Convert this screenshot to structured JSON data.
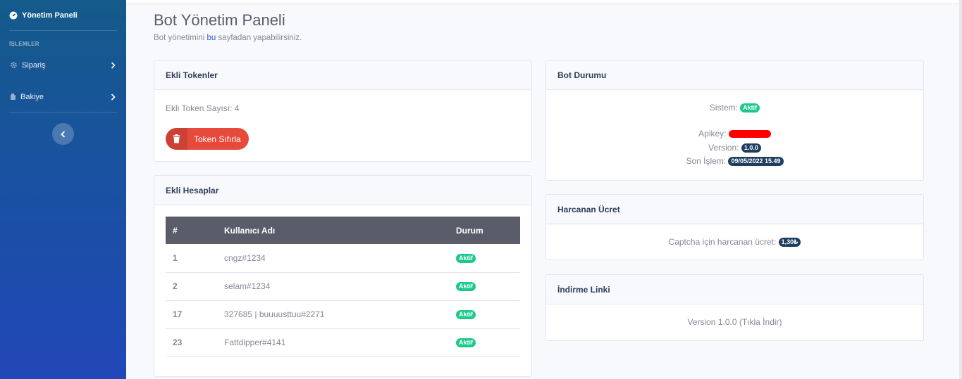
{
  "sidebar": {
    "brand": "Yönetim Paneli",
    "heading": "İŞLEMLER",
    "items": [
      {
        "label": "Sipariş"
      },
      {
        "label": "Bakiye"
      }
    ]
  },
  "header": {
    "title": "Bot Yönetim Paneli",
    "subtitle_pre": "Bot yönetimini ",
    "subtitle_hl": "bu",
    "subtitle_post": " sayfadan yapabilirsiniz."
  },
  "tokens": {
    "title": "Ekli Tokenler",
    "count_text": "Ekli Token Sayısı: 4",
    "reset_label": "Token Sıfırla"
  },
  "accounts": {
    "title": "Ekli Hesaplar",
    "columns": [
      "#",
      "Kullanıcı Adı",
      "Durum"
    ],
    "rows": [
      {
        "id": "1",
        "user": "cngz#1234",
        "status": "Aktif"
      },
      {
        "id": "2",
        "user": "selam#1234",
        "status": "Aktif"
      },
      {
        "id": "17",
        "user": "327685 | buuuusttuu#2271",
        "status": "Aktif"
      },
      {
        "id": "23",
        "user": "Fattdipper#4141",
        "status": "Aktif"
      }
    ]
  },
  "bot_status": {
    "title": "Bot Durumu",
    "system_label": "Sistem:",
    "system_value": "Aktif",
    "apikey_label": "Apikey:",
    "version_label": "Version:",
    "version_value": "1.0.0",
    "last_label": "Son İşlem:",
    "last_value": "09/05/2022 15.49"
  },
  "cost": {
    "title": "Harcanan Ücret",
    "label": "Captcha için harcanan ücret:",
    "value": "1,30₺"
  },
  "download": {
    "title": "İndirme Linki",
    "text_pre": "Version 1.0.0 (",
    "link": "Tıkla İndir",
    "text_post": ")"
  },
  "colors": {
    "sidebar_top": "#145a8a",
    "sidebar_bottom": "#2247b8",
    "success": "#1cc88a",
    "danger": "#e74a3b",
    "badge_dark": "#1e3f5f",
    "redaction": "#ff0000"
  }
}
